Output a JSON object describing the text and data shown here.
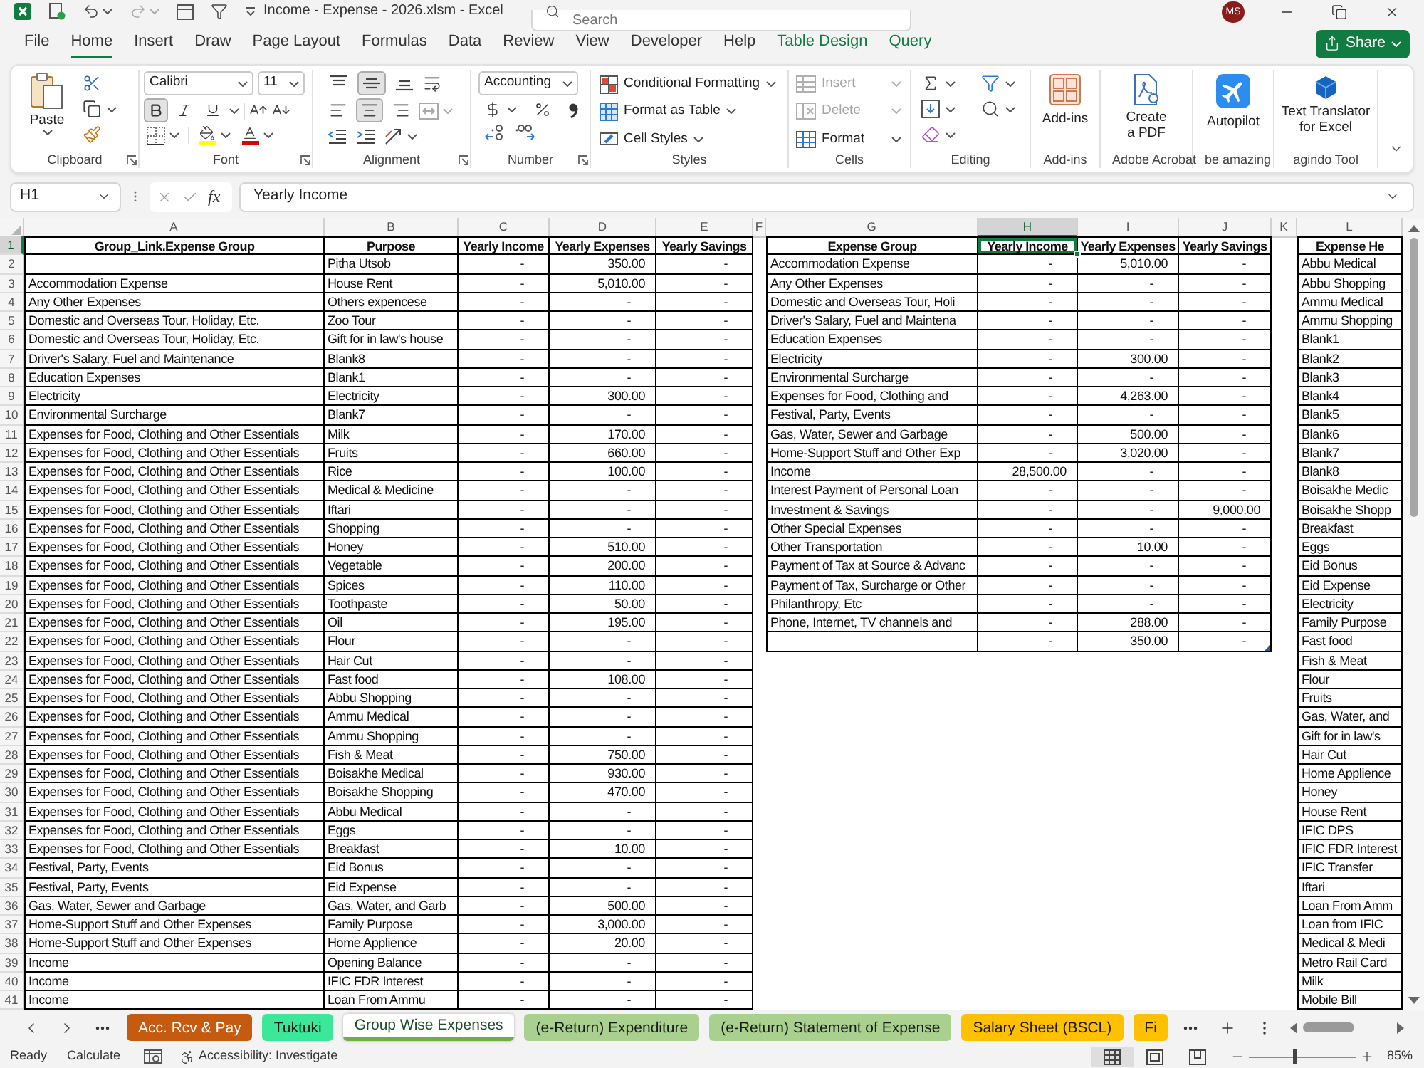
{
  "title_bar": {
    "title": "Income - Expense - 2026.xlsm - Excel",
    "search": {
      "placeholder": "Search"
    },
    "avatar": "MS"
  },
  "menu_tabs": [
    {
      "label": "File",
      "kind": "standard",
      "selected": false
    },
    {
      "label": "Home",
      "kind": "standard",
      "selected": true
    },
    {
      "label": "Insert",
      "kind": "standard",
      "selected": false
    },
    {
      "label": "Draw",
      "kind": "standard",
      "selected": false
    },
    {
      "label": "Page Layout",
      "kind": "standard",
      "selected": false
    },
    {
      "label": "Formulas",
      "kind": "standard",
      "selected": false
    },
    {
      "label": "Data",
      "kind": "standard",
      "selected": false
    },
    {
      "label": "Review",
      "kind": "standard",
      "selected": false
    },
    {
      "label": "View",
      "kind": "standard",
      "selected": false
    },
    {
      "label": "Developer",
      "kind": "standard",
      "selected": false
    },
    {
      "label": "Help",
      "kind": "standard",
      "selected": false
    },
    {
      "label": "Table Design",
      "kind": "contextual",
      "selected": false
    },
    {
      "label": "Query",
      "kind": "contextual",
      "selected": false
    }
  ],
  "share_button": {
    "label": "Share"
  },
  "ribbon": {
    "clipboard": {
      "paste": "Paste",
      "label": "Clipboard"
    },
    "font": {
      "name": "Calibri",
      "size": "11",
      "bold": true,
      "italic": false,
      "underline": false,
      "label": "Font"
    },
    "alignment": {
      "vertical": [
        {
          "kind": "top",
          "selected": false
        },
        {
          "kind": "middle",
          "selected": true
        },
        {
          "kind": "bottom",
          "selected": false
        }
      ],
      "horizontal": [
        {
          "kind": "left",
          "selected": false
        },
        {
          "kind": "center",
          "selected": true
        },
        {
          "kind": "right",
          "selected": false
        }
      ],
      "label": "Alignment"
    },
    "number": {
      "format": "Accounting",
      "label": "Number"
    },
    "styles": {
      "buttons": [
        "Conditional Formatting",
        "Format as Table",
        "Cell Styles"
      ],
      "label": "Styles"
    },
    "cells": {
      "buttons": [
        {
          "label": "Insert",
          "disabled": true
        },
        {
          "label": "Delete",
          "disabled": true
        },
        {
          "label": "Format",
          "disabled": false
        }
      ],
      "label": "Cells"
    },
    "editing": {
      "label": "Editing"
    },
    "add_ins": {
      "button": "Add-ins",
      "label": "Add-ins"
    },
    "adobe_acrobat": {
      "button": "Create a PDF",
      "label": "Adobe Acrobat"
    },
    "be_amazing": {
      "button": "Autopilot",
      "label": "be amazing"
    },
    "agindo_tool": {
      "button": "Text Translator for Excel",
      "label": "agindo Tool"
    }
  },
  "formula_bar": {
    "name_box": "H1",
    "function_button": "fx",
    "formula": "Yearly Income"
  },
  "column_headers": [
    {
      "label": "A",
      "selected": false
    },
    {
      "label": "B",
      "selected": false
    },
    {
      "label": "C",
      "selected": false
    },
    {
      "label": "D",
      "selected": false
    },
    {
      "label": "E",
      "selected": false
    },
    {
      "label": "F",
      "selected": false
    },
    {
      "label": "G",
      "selected": false
    },
    {
      "label": "H",
      "selected": true
    },
    {
      "label": "I",
      "selected": false
    },
    {
      "label": "J",
      "selected": false
    },
    {
      "label": "K",
      "selected": false
    },
    {
      "label": "L",
      "selected": false
    }
  ],
  "row_headers": [
    {
      "label": "1",
      "selected": true
    },
    {
      "label": "2",
      "selected": false
    },
    {
      "label": "3",
      "selected": false
    },
    {
      "label": "4",
      "selected": false
    },
    {
      "label": "5",
      "selected": false
    },
    {
      "label": "6",
      "selected": false
    },
    {
      "label": "7",
      "selected": false
    },
    {
      "label": "8",
      "selected": false
    },
    {
      "label": "9",
      "selected": false
    },
    {
      "label": "10",
      "selected": false
    },
    {
      "label": "11",
      "selected": false
    },
    {
      "label": "12",
      "selected": false
    },
    {
      "label": "13",
      "selected": false
    },
    {
      "label": "14",
      "selected": false
    },
    {
      "label": "15",
      "selected": false
    },
    {
      "label": "16",
      "selected": false
    },
    {
      "label": "17",
      "selected": false
    },
    {
      "label": "18",
      "selected": false
    },
    {
      "label": "19",
      "selected": false
    },
    {
      "label": "20",
      "selected": false
    },
    {
      "label": "21",
      "selected": false
    },
    {
      "label": "22",
      "selected": false
    },
    {
      "label": "23",
      "selected": false
    },
    {
      "label": "24",
      "selected": false
    },
    {
      "label": "25",
      "selected": false
    },
    {
      "label": "26",
      "selected": false
    },
    {
      "label": "27",
      "selected": false
    },
    {
      "label": "28",
      "selected": false
    },
    {
      "label": "29",
      "selected": false
    },
    {
      "label": "30",
      "selected": false
    },
    {
      "label": "31",
      "selected": false
    },
    {
      "label": "32",
      "selected": false
    },
    {
      "label": "33",
      "selected": false
    },
    {
      "label": "34",
      "selected": false
    },
    {
      "label": "35",
      "selected": false
    },
    {
      "label": "36",
      "selected": false
    },
    {
      "label": "37",
      "selected": false
    },
    {
      "label": "38",
      "selected": false
    },
    {
      "label": "39",
      "selected": false
    },
    {
      "label": "40",
      "selected": false
    },
    {
      "label": "41",
      "selected": false
    }
  ],
  "expense_table": {
    "columns": [
      "Group_Link.Expense Group",
      "Purpose",
      "Yearly Income",
      "Yearly Expenses",
      "Yearly Savings"
    ],
    "rows": [
      {
        "purpose": "Pitha Utsob",
        "income": "-",
        "expenses": "350.00",
        "savings": "-"
      },
      {
        "group": "Accommodation Expense",
        "purpose": "House Rent",
        "income": "-",
        "expenses": "5,010.00",
        "savings": "-"
      },
      {
        "group": "Any Other Expenses",
        "purpose": "Others expencese",
        "income": "-",
        "expenses": "-",
        "savings": "-"
      },
      {
        "group": "Domestic and Overseas Tour, Holiday, Etc.",
        "purpose": "Zoo Tour",
        "income": "-",
        "expenses": "-",
        "savings": "-"
      },
      {
        "group": "Domestic and Overseas Tour, Holiday, Etc.",
        "purpose": "Gift for in law's house",
        "income": "-",
        "expenses": "-",
        "savings": "-"
      },
      {
        "group": "Driver's Salary, Fuel and Maintenance",
        "purpose": "Blank8",
        "income": "-",
        "expenses": "-",
        "savings": "-"
      },
      {
        "group": "Education Expenses",
        "purpose": "Blank1",
        "income": "-",
        "expenses": "-",
        "savings": "-"
      },
      {
        "group": "Electricity",
        "purpose": "Electricity",
        "income": "-",
        "expenses": "300.00",
        "savings": "-"
      },
      {
        "group": "Environmental Surcharge",
        "purpose": "Blank7",
        "income": "-",
        "expenses": "-",
        "savings": "-"
      },
      {
        "group": "Expenses for Food, Clothing and Other Essentials",
        "purpose": "Milk",
        "income": "-",
        "expenses": "170.00",
        "savings": "-"
      },
      {
        "group": "Expenses for Food, Clothing and Other Essentials",
        "purpose": "Fruits",
        "income": "-",
        "expenses": "660.00",
        "savings": "-"
      },
      {
        "group": "Expenses for Food, Clothing and Other Essentials",
        "purpose": "Rice",
        "income": "-",
        "expenses": "100.00",
        "savings": "-"
      },
      {
        "group": "Expenses for Food, Clothing and Other Essentials",
        "purpose": "Medical & Medicine",
        "income": "-",
        "expenses": "-",
        "savings": "-"
      },
      {
        "group": "Expenses for Food, Clothing and Other Essentials",
        "purpose": "Iftari",
        "income": "-",
        "expenses": "-",
        "savings": "-"
      },
      {
        "group": "Expenses for Food, Clothing and Other Essentials",
        "purpose": "Shopping",
        "income": "-",
        "expenses": "-",
        "savings": "-"
      },
      {
        "group": "Expenses for Food, Clothing and Other Essentials",
        "purpose": "Honey",
        "income": "-",
        "expenses": "510.00",
        "savings": "-"
      },
      {
        "group": "Expenses for Food, Clothing and Other Essentials",
        "purpose": "Vegetable",
        "income": "-",
        "expenses": "200.00",
        "savings": "-"
      },
      {
        "group": "Expenses for Food, Clothing and Other Essentials",
        "purpose": "Spices",
        "income": "-",
        "expenses": "110.00",
        "savings": "-"
      },
      {
        "group": "Expenses for Food, Clothing and Other Essentials",
        "purpose": "Toothpaste",
        "income": "-",
        "expenses": "50.00",
        "savings": "-"
      },
      {
        "group": "Expenses for Food, Clothing and Other Essentials",
        "purpose": "Oil",
        "income": "-",
        "expenses": "195.00",
        "savings": "-"
      },
      {
        "group": "Expenses for Food, Clothing and Other Essentials",
        "purpose": "Flour",
        "income": "-",
        "expenses": "-",
        "savings": "-"
      },
      {
        "group": "Expenses for Food, Clothing and Other Essentials",
        "purpose": "Hair Cut",
        "income": "-",
        "expenses": "-",
        "savings": "-"
      },
      {
        "group": "Expenses for Food, Clothing and Other Essentials",
        "purpose": "Fast food",
        "income": "-",
        "expenses": "108.00",
        "savings": "-"
      },
      {
        "group": "Expenses for Food, Clothing and Other Essentials",
        "purpose": "Abbu Shopping",
        "income": "-",
        "expenses": "-",
        "savings": "-"
      },
      {
        "group": "Expenses for Food, Clothing and Other Essentials",
        "purpose": "Ammu Medical",
        "income": "-",
        "expenses": "-",
        "savings": "-"
      },
      {
        "group": "Expenses for Food, Clothing and Other Essentials",
        "purpose": "Ammu Shopping",
        "income": "-",
        "expenses": "-",
        "savings": "-"
      },
      {
        "group": "Expenses for Food, Clothing and Other Essentials",
        "purpose": "Fish & Meat",
        "income": "-",
        "expenses": "750.00",
        "savings": "-"
      },
      {
        "group": "Expenses for Food, Clothing and Other Essentials",
        "purpose": "Boisakhe Medical",
        "income": "-",
        "expenses": "930.00",
        "savings": "-"
      },
      {
        "group": "Expenses for Food, Clothing and Other Essentials",
        "purpose": "Boisakhe Shopping",
        "income": "-",
        "expenses": "470.00",
        "savings": "-"
      },
      {
        "group": "Expenses for Food, Clothing and Other Essentials",
        "purpose": "Abbu Medical",
        "income": "-",
        "expenses": "-",
        "savings": "-"
      },
      {
        "group": "Expenses for Food, Clothing and Other Essentials",
        "purpose": "Eggs",
        "income": "-",
        "expenses": "-",
        "savings": "-"
      },
      {
        "group": "Expenses for Food, Clothing and Other Essentials",
        "purpose": "Breakfast",
        "income": "-",
        "expenses": "10.00",
        "savings": "-"
      },
      {
        "group": "Festival, Party, Events",
        "purpose": "Eid Bonus",
        "income": "-",
        "expenses": "-",
        "savings": "-"
      },
      {
        "group": "Festival, Party, Events",
        "purpose": "Eid Expense",
        "income": "-",
        "expenses": "-",
        "savings": "-"
      },
      {
        "group": "Gas, Water, Sewer and Garbage",
        "purpose": "Gas, Water, and Garb",
        "income": "-",
        "expenses": "500.00",
        "savings": "-"
      },
      {
        "group": "Home-Support Stuff and Other Expenses",
        "purpose": "Family Purpose",
        "income": "-",
        "expenses": "3,000.00",
        "savings": "-"
      },
      {
        "group": "Home-Support Stuff and Other Expenses",
        "purpose": "Home Applience",
        "income": "-",
        "expenses": "20.00",
        "savings": "-"
      },
      {
        "group": "Income",
        "purpose": "Opening Balance",
        "income": "-",
        "expenses": "-",
        "savings": "-"
      },
      {
        "group": "Income",
        "purpose": "IFIC FDR Interest",
        "income": "-",
        "expenses": "-",
        "savings": "-"
      },
      {
        "group": "Income",
        "purpose": "Loan From Ammu",
        "income": "-",
        "expenses": "-",
        "savings": "-"
      }
    ]
  },
  "summary_table": {
    "columns": [
      {
        "label": "Expense Group",
        "selected": false
      },
      {
        "label": "Yearly Income",
        "selected": true
      },
      {
        "label": "Yearly Expenses",
        "selected": false
      },
      {
        "label": "Yearly Savings",
        "selected": false
      }
    ],
    "rows": [
      {
        "expense_group": "Accommodation Expense",
        "yearly_income": "-",
        "yearly_expenses": "5,010.00",
        "yearly_savings": "-"
      },
      {
        "expense_group": "Any Other Expenses",
        "yearly_income": "-",
        "yearly_expenses": "-",
        "yearly_savings": "-"
      },
      {
        "expense_group": "Domestic and Overseas Tour, Holi",
        "yearly_income": "-",
        "yearly_expenses": "-",
        "yearly_savings": "-"
      },
      {
        "expense_group": "Driver's Salary, Fuel and Maintena",
        "yearly_income": "-",
        "yearly_expenses": "-",
        "yearly_savings": "-"
      },
      {
        "expense_group": "Education Expenses",
        "yearly_income": "-",
        "yearly_expenses": "-",
        "yearly_savings": "-"
      },
      {
        "expense_group": "Electricity",
        "yearly_income": "-",
        "yearly_expenses": "300.00",
        "yearly_savings": "-"
      },
      {
        "expense_group": "Environmental Surcharge",
        "yearly_income": "-",
        "yearly_expenses": "-",
        "yearly_savings": "-"
      },
      {
        "expense_group": "Expenses for Food, Clothing and",
        "yearly_income": "-",
        "yearly_expenses": "4,263.00",
        "yearly_savings": "-"
      },
      {
        "expense_group": "Festival, Party, Events",
        "yearly_income": "-",
        "yearly_expenses": "-",
        "yearly_savings": "-"
      },
      {
        "expense_group": "Gas, Water, Sewer and Garbage",
        "yearly_income": "-",
        "yearly_expenses": "500.00",
        "yearly_savings": "-"
      },
      {
        "expense_group": "Home-Support Stuff and Other Exp",
        "yearly_income": "-",
        "yearly_expenses": "3,020.00",
        "yearly_savings": "-"
      },
      {
        "expense_group": "Income",
        "yearly_income": "28,500.00",
        "yearly_expenses": "-",
        "yearly_savings": "-"
      },
      {
        "expense_group": "Interest Payment of Personal Loan",
        "yearly_income": "-",
        "yearly_expenses": "-",
        "yearly_savings": "-"
      },
      {
        "expense_group": "Investment & Savings",
        "yearly_income": "-",
        "yearly_expenses": "-",
        "yearly_savings": "9,000.00"
      },
      {
        "expense_group": "Other Special Expenses",
        "yearly_income": "-",
        "yearly_expenses": "-",
        "yearly_savings": "-"
      },
      {
        "expense_group": "Other Transportation",
        "yearly_income": "-",
        "yearly_expenses": "10.00",
        "yearly_savings": "-"
      },
      {
        "expense_group": "Payment of Tax at Source & Advanc",
        "yearly_income": "-",
        "yearly_expenses": "-",
        "yearly_savings": "-"
      },
      {
        "expense_group": "Payment of Tax, Surcharge or Other",
        "yearly_income": "-",
        "yearly_expenses": "-",
        "yearly_savings": "-"
      },
      {
        "expense_group": "Philanthropy, Etc",
        "yearly_income": "-",
        "yearly_expenses": "-",
        "yearly_savings": "-"
      },
      {
        "expense_group": "Phone, Internet, TV channels and",
        "yearly_income": "-",
        "yearly_expenses": "288.00",
        "yearly_savings": "-"
      },
      {
        "yearly_income": "-",
        "yearly_expenses": "350.00",
        "yearly_savings": "-"
      }
    ]
  },
  "expense_heads": {
    "column": "Expense He",
    "items": [
      "Abbu Medical",
      "Abbu Shopping",
      "Ammu Medical",
      "Ammu Shopping",
      "Blank1",
      "Blank2",
      "Blank3",
      "Blank4",
      "Blank5",
      "Blank6",
      "Blank7",
      "Blank8",
      "Boisakhe Medic",
      "Boisakhe Shopp",
      "Breakfast",
      "Eggs",
      "Eid Bonus",
      "Eid Expense",
      "Electricity",
      "Family Purpose",
      "Fast food",
      "Fish & Meat",
      "Flour",
      "Fruits",
      "Gas, Water, and",
      "Gift for in law's",
      "Hair Cut",
      "Home Applience",
      "Honey",
      "House Rent",
      "IFIC DPS",
      "IFIC FDR Interest",
      "IFIC Transfer",
      "Iftari",
      "Loan From Amm",
      "Loan from IFIC",
      "Medical & Medi",
      "Metro Rail Card",
      "Milk",
      "Mobile Bill"
    ]
  },
  "sheet_tabs": [
    {
      "label": "Acc. Rcv & Pay",
      "color": "#c55a11",
      "selected": false
    },
    {
      "label": "Tuktuki",
      "color": "#3be89a",
      "selected": false
    },
    {
      "label": "Group Wise Expenses",
      "color": "#70ad47",
      "selected": true
    },
    {
      "label": "(e-Return) Expenditure",
      "color": "#a9d08e",
      "selected": false
    },
    {
      "label": "(e-Return) Statement of Expense",
      "color": "#a9d08e",
      "selected": false
    },
    {
      "label": "Salary Sheet (BSCL)",
      "color": "#ffc000",
      "selected": false
    },
    {
      "label": "Fi",
      "color": "#ffc000",
      "selected": false
    }
  ],
  "status_bar": {
    "mode": "Ready",
    "calculate": "Calculate",
    "accessibility": "Accessibility: Investigate",
    "views": [
      {
        "kind": "normal",
        "selected": true
      },
      {
        "kind": "page_layout",
        "selected": false
      },
      {
        "kind": "page_break",
        "selected": false
      }
    ],
    "zoom": {
      "level": 0.43,
      "reading": "85%"
    }
  }
}
